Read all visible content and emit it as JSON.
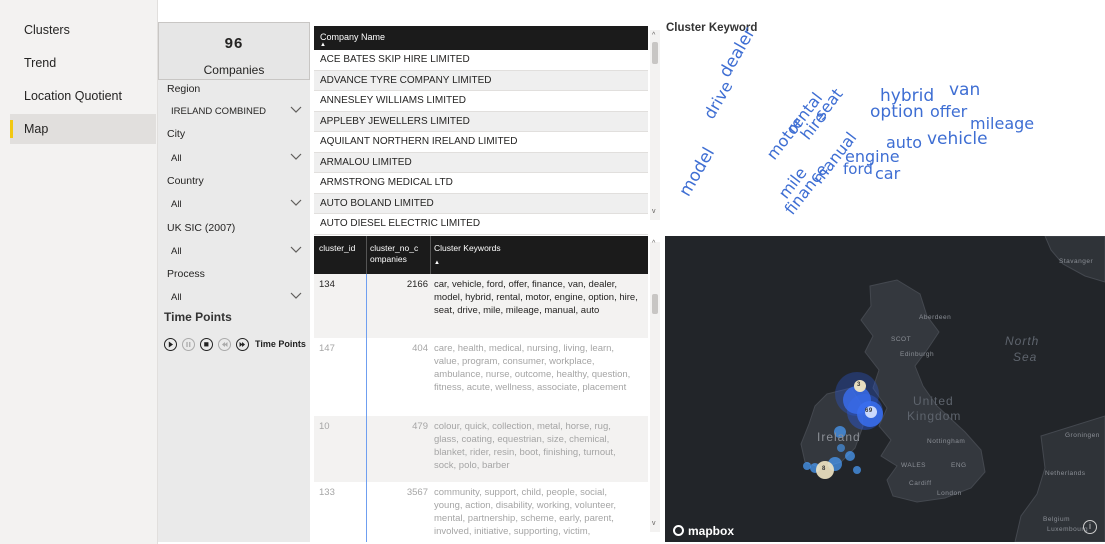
{
  "nav": {
    "items": [
      {
        "label": "Clusters"
      },
      {
        "label": "Trend"
      },
      {
        "label": "Location Quotient"
      },
      {
        "label": "Map"
      }
    ]
  },
  "kpi": {
    "value": "96",
    "label": "Companies"
  },
  "slicers": {
    "region": {
      "title": "Region",
      "value": "IRELAND COMBINED"
    },
    "city": {
      "title": "City",
      "value": "All"
    },
    "country": {
      "title": "Country",
      "value": "All"
    },
    "sic": {
      "title": "UK SIC (2007)",
      "value": "All"
    },
    "process": {
      "title": "Process",
      "value": "All"
    }
  },
  "time_points": {
    "title": "Time Points",
    "player_label": "Time Points"
  },
  "company_table": {
    "header": "Company Name",
    "rows": [
      "ACE BATES SKIP HIRE LIMITED",
      "ADVANCE TYRE COMPANY LIMITED",
      "ANNESLEY WILLIAMS LIMITED",
      "APPLEBY JEWELLERS LIMITED",
      "AQUILANT NORTHERN IRELAND LIMITED",
      "ARMALOU LIMITED",
      "ARMSTRONG MEDICAL LTD",
      "AUTO BOLAND LIMITED",
      "AUTO DIESEL ELECTRIC LIMITED"
    ]
  },
  "cluster_table": {
    "headers": {
      "id": "cluster_id",
      "count": "cluster_no_c ompanies",
      "keywords": "Cluster Keywords"
    },
    "rows": [
      {
        "id": "134",
        "count": "2166",
        "keywords": "car, vehicle, ford, offer, finance, van, dealer, model, hybrid, rental, motor, engine, option, hire, seat, drive, mile, mileage, manual, auto"
      },
      {
        "id": "147",
        "count": "404",
        "keywords": "care, health, medical, nursing, living, learn, value, program, consumer, workplace, ambulance, nurse, outcome, healthy, question, fitness, acute, wellness, associate, placement"
      },
      {
        "id": "10",
        "count": "479",
        "keywords": "colour, quick, collection, metal, horse, rug, glass, coating, equestrian, size, chemical, blanket, rider, resin, boot, finishing, turnout, sock, polo, barber"
      },
      {
        "id": "133",
        "count": "3567",
        "keywords": "community, support, child, people, social, young, action, disability, working, volunteer, mental, partnership, scheme, early, parent, involved, initiative, supporting, victim,"
      }
    ]
  },
  "word_cloud": {
    "title": "Cluster Keyword",
    "color": "#3e6ed3",
    "words": [
      "dealer",
      "drive",
      "model",
      "motor",
      "rental",
      "hire",
      "seat",
      "mile",
      "finance",
      "manual",
      "engine",
      "ford",
      "car",
      "auto",
      "hybrid",
      "offer",
      "mileage",
      "option",
      "vehicle",
      "van"
    ]
  },
  "map": {
    "labels": {
      "stavanger": "Stavanger",
      "aberdeen": "Aberdeen",
      "scot": "SCOT",
      "edinburgh": "Edinburgh",
      "north_sea": "North",
      "north_sea2": "Sea",
      "uk1": "United",
      "uk2": "Kingdom",
      "ireland": "Ireland",
      "nottingham": "Nottingham",
      "groningen": "Groningen",
      "wales": "WALES",
      "eng": "ENG",
      "cardiff": "Cardiff",
      "london": "London",
      "netherlands": "Netherlands",
      "belgium": "Belgium",
      "luxembourg": "Luxembourg"
    },
    "cluster_markers": [
      "3",
      "69",
      "8"
    ],
    "brand": "mapbox",
    "info": "i"
  }
}
